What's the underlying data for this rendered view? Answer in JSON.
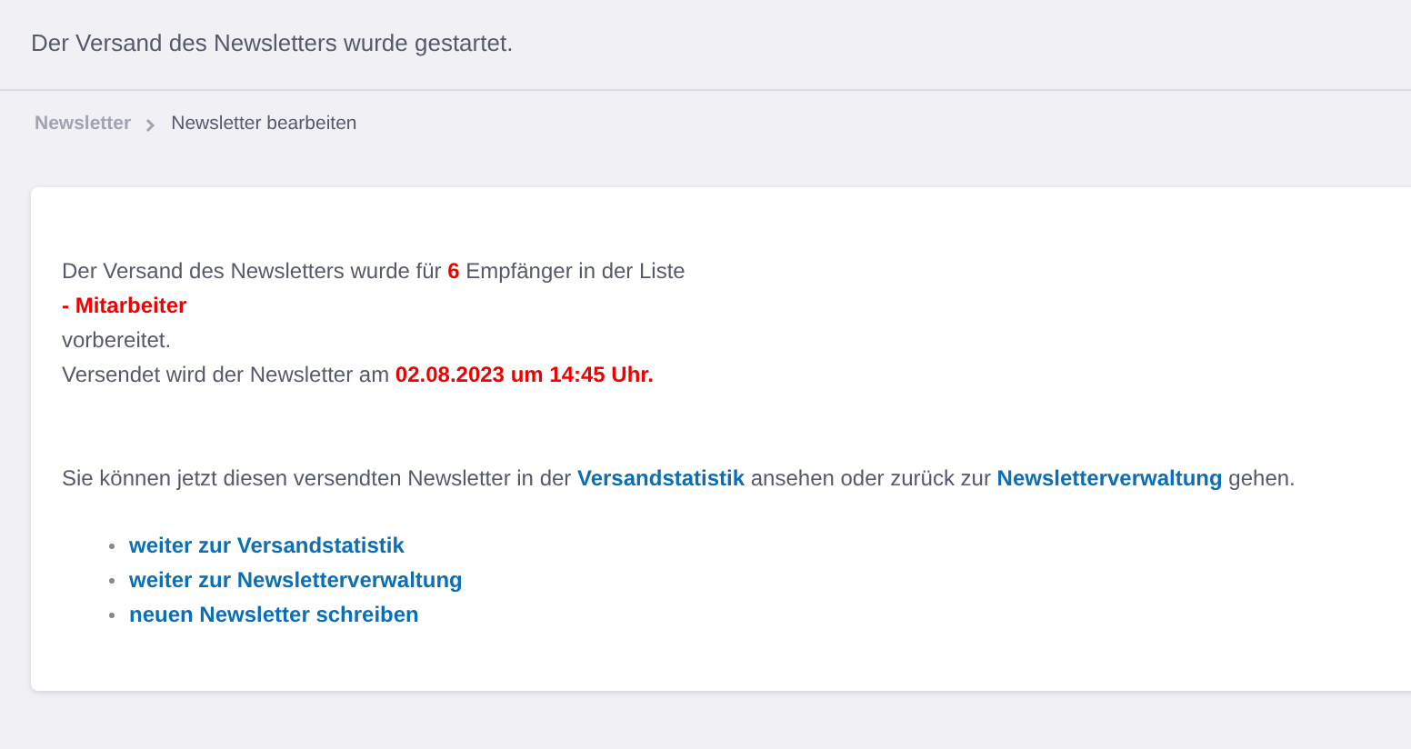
{
  "notice": "Der Versand des Newsletters wurde gestartet.",
  "breadcrumb": [
    {
      "label": "Newsletter",
      "current": false
    },
    {
      "label": "Newsletter bearbeiten",
      "current": true
    }
  ],
  "summary_lines": [
    [
      {
        "kind": "text",
        "text": "Der Versand des Newsletters wurde für "
      },
      {
        "kind": "highlight",
        "text": "6"
      },
      {
        "kind": "text",
        "text": " Empfänger in der Liste"
      }
    ],
    [
      {
        "kind": "highlight",
        "text": "- Mitarbeiter"
      }
    ],
    [
      {
        "kind": "text",
        "text": "vorbereitet."
      }
    ],
    [
      {
        "kind": "text",
        "text": "Versendet wird der Newsletter am "
      },
      {
        "kind": "highlight",
        "text": "02.08.2023 um 14:45 Uhr."
      }
    ]
  ],
  "info": [
    {
      "kind": "text",
      "text": "Sie können jetzt diesen versendten Newsletter in der "
    },
    {
      "kind": "link",
      "text": "Versandstatistik"
    },
    {
      "kind": "text",
      "text": " ansehen oder zurück zur "
    },
    {
      "kind": "link",
      "text": "Newsletterverwaltung"
    },
    {
      "kind": "text",
      "text": " gehen."
    }
  ],
  "links": [
    "weiter zur Versandstatistik",
    "weiter zur Newsletterverwaltung",
    "neuen Newsletter schreiben"
  ]
}
